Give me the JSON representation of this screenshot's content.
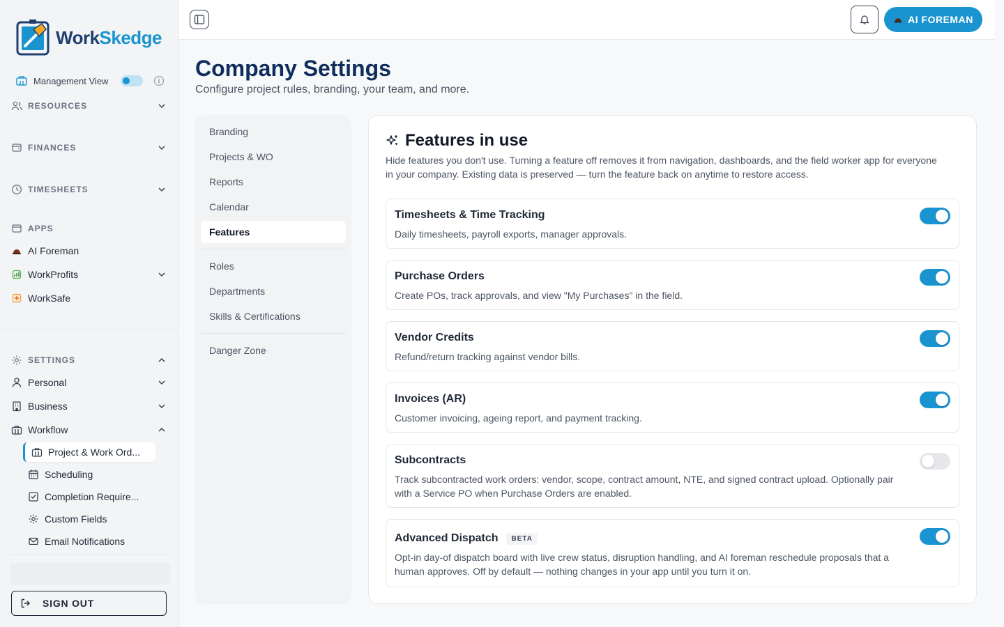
{
  "brand": {
    "name_part1": "Work",
    "name_part2": "Skedge"
  },
  "sidebar": {
    "management_view": "Management View",
    "sections": {
      "resources": "RESOURCES",
      "finances": "FINANCES",
      "timesheets": "TIMESHEETS",
      "apps": "APPS",
      "settings": "SETTINGS"
    },
    "apps": [
      "AI Foreman",
      "WorkProfits",
      "WorkSafe"
    ],
    "settings_items": [
      "Personal",
      "Business",
      "Workflow"
    ],
    "workflow_sub": [
      "Project & Work Ord...",
      "Scheduling",
      "Completion Require...",
      "Custom Fields",
      "Email Notifications"
    ],
    "sign_out": "SIGN OUT"
  },
  "topbar": {
    "ai_button": "AI FOREMAN"
  },
  "page": {
    "title": "Company Settings",
    "subtitle": "Configure project rules, branding, your team, and more."
  },
  "subnav": {
    "group1": [
      "Branding",
      "Projects & WO",
      "Reports",
      "Calendar",
      "Features"
    ],
    "group2": [
      "Roles",
      "Departments",
      "Skills & Certifications"
    ],
    "group3": [
      "Danger Zone"
    ],
    "active": "Features"
  },
  "features_card": {
    "title": "Features in use",
    "description": "Hide features you don't use. Turning a feature off removes it from navigation, dashboards, and the field worker app for everyone in your company. Existing data is preserved — turn the feature back on anytime to restore access.",
    "features": [
      {
        "name": "Timesheets & Time Tracking",
        "desc": "Daily timesheets, payroll exports, manager approvals.",
        "enabled": true
      },
      {
        "name": "Purchase Orders",
        "desc": "Create POs, track approvals, and view \"My Purchases\" in the field.",
        "enabled": true
      },
      {
        "name": "Vendor Credits",
        "desc": "Refund/return tracking against vendor bills.",
        "enabled": true
      },
      {
        "name": "Invoices (AR)",
        "desc": "Customer invoicing, ageing report, and payment tracking.",
        "enabled": true
      },
      {
        "name": "Subcontracts",
        "desc": "Track subcontracted work orders: vendor, scope, contract amount, NTE, and signed contract upload. Optionally pair with a Service PO when Purchase Orders are enabled.",
        "enabled": false
      },
      {
        "name": "Advanced Dispatch",
        "badge": "BETA",
        "desc": "Opt-in day-of dispatch board with live crew status, disruption handling, and AI foreman reschedule proposals that a human approves. Off by default — nothing changes in your app until you turn it on.",
        "enabled": true
      }
    ]
  },
  "colors": {
    "accent": "#1a94d0",
    "title": "#0f2d5c",
    "brand_dark": "#1f3f70"
  }
}
